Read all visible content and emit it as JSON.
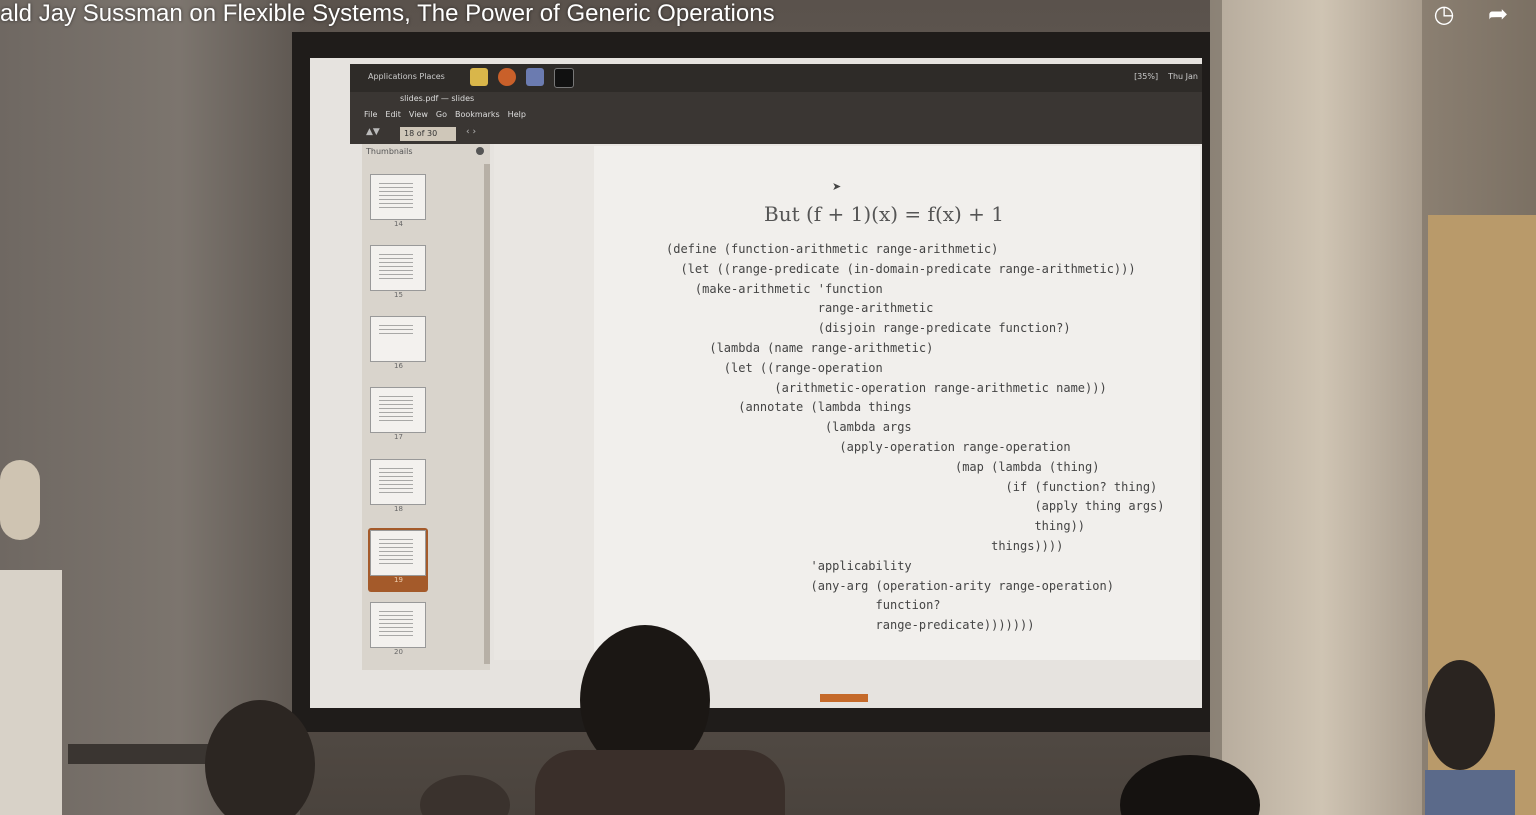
{
  "video": {
    "title": "ald Jay Sussman on Flexible Systems, The Power of Generic Operations",
    "icons": [
      "watch-later-icon",
      "share-icon"
    ]
  },
  "desktop": {
    "top_bar_left": "Applications  Places",
    "top_bar_right": [
      "[35%]",
      "Thu Jan"
    ],
    "window_title": "slides.pdf — slides",
    "menu": [
      "File",
      "Edit",
      "View",
      "Go",
      "Bookmarks",
      "Help"
    ],
    "page_indicator": "18   of 30"
  },
  "sidebar": {
    "header": "Thumbnails",
    "thumbnails": [
      {
        "num": "14"
      },
      {
        "num": "15"
      },
      {
        "num": "16"
      },
      {
        "num": "17"
      },
      {
        "num": "18"
      },
      {
        "num": "19",
        "selected": true
      },
      {
        "num": "20"
      }
    ]
  },
  "slide": {
    "title": "But (f + 1)(x) = f(x) + 1",
    "code": [
      "(define (function-arithmetic range-arithmetic)",
      "  (let ((range-predicate (in-domain-predicate range-arithmetic)))",
      "    (make-arithmetic 'function",
      "                     range-arithmetic",
      "                     (disjoin range-predicate function?)",
      "      (lambda (name range-arithmetic)",
      "        (let ((range-operation",
      "               (arithmetic-operation range-arithmetic name)))",
      "          (annotate (lambda things",
      "                      (lambda args",
      "                        (apply-operation range-operation",
      "                                        (map (lambda (thing)",
      "                                               (if (function? thing)",
      "                                                   (apply thing args)",
      "                                                   thing))",
      "                                             things))))",
      "                    'applicability",
      "                    (any-arg (operation-arity range-operation)",
      "                             function?",
      "                             range-predicate)))))))"
    ]
  }
}
